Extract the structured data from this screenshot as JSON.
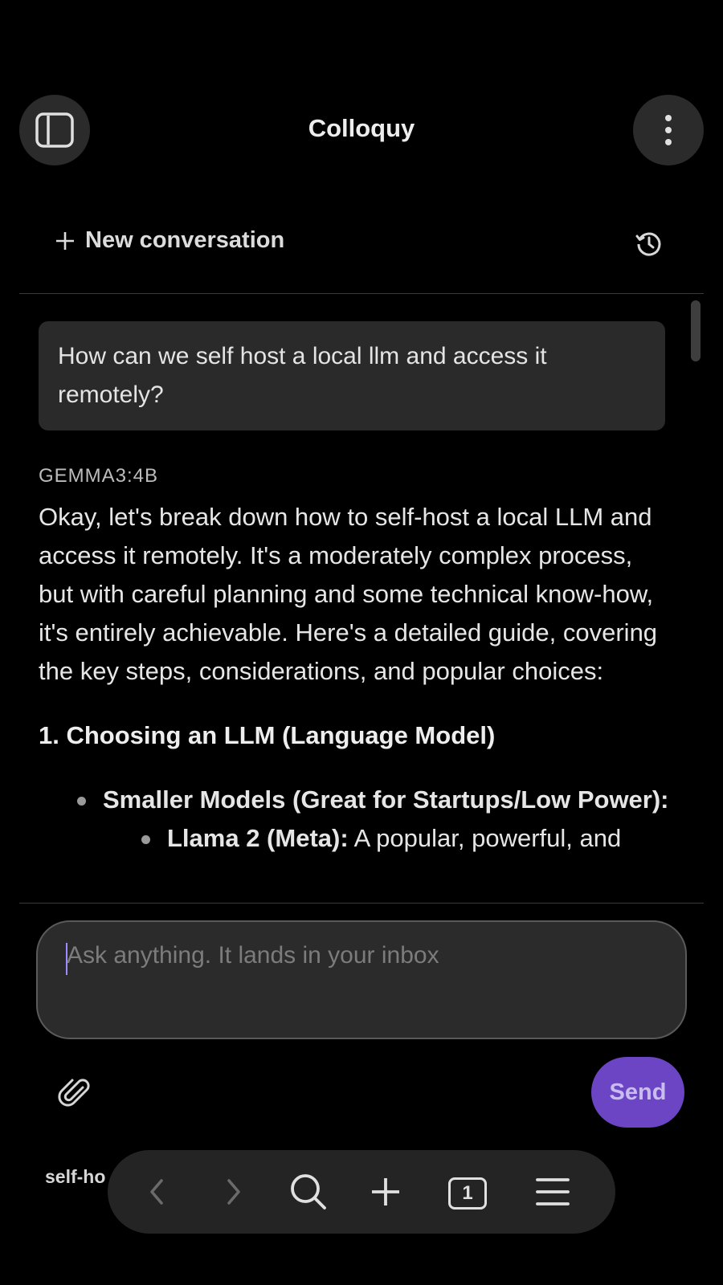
{
  "header": {
    "title": "Colloquy",
    "sidebar_icon": "sidebar-toggle-icon",
    "menu_icon": "kebab-menu-icon"
  },
  "toolbar": {
    "new_conversation_label": "New conversation",
    "history_icon": "history-icon"
  },
  "chat": {
    "messages": [
      {
        "role": "user",
        "text": "How can we self host a local llm and access it remotely?"
      },
      {
        "role": "assistant",
        "model": "GEMMA3:4B",
        "intro": "Okay, let's break down how to self-host a local LLM and access it remotely. It's a moderately complex process, but with careful planning and some technical know-how, it's entirely achievable. Here's a detailed guide, covering the key steps, considerations, and popular choices:",
        "section_heading": "1. Choosing an LLM (Language Model)",
        "bullet_1": "Smaller Models (Great for Startups/Low Power):",
        "sub_bullet_1_bold": "Llama 2 (Meta):",
        "sub_bullet_1_text": " A popular, powerful, and"
      }
    ]
  },
  "composer": {
    "placeholder": "Ask anything. It lands in your inbox",
    "value": "",
    "attach_icon": "paperclip-icon",
    "send_label": "Send"
  },
  "browser": {
    "page_url_partial": "self-ho",
    "tab_count": "1",
    "icons": [
      "back-icon",
      "forward-icon",
      "search-icon",
      "plus-icon",
      "tabs-icon",
      "hamburger-menu-icon"
    ]
  },
  "colors": {
    "background": "#000000",
    "bubble": "#2a2a2a",
    "send_button": "#6b45c4",
    "browser_bar": "#242424"
  }
}
